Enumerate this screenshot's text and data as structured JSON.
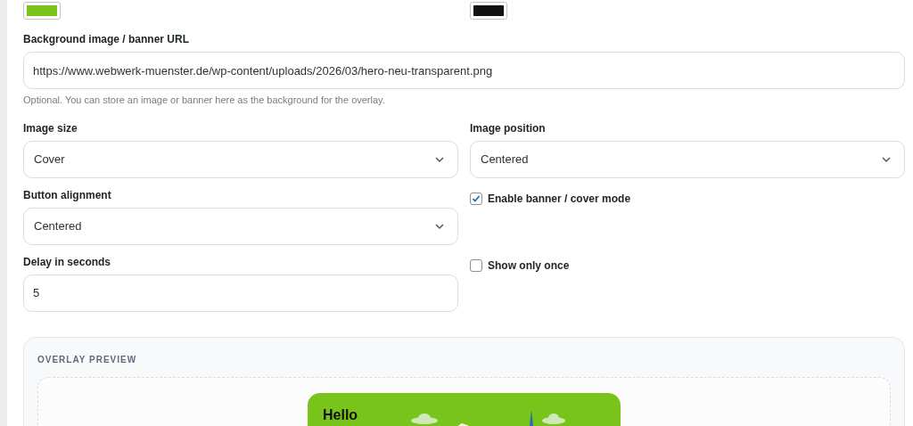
{
  "color_swatches": [
    {
      "color": "#7ac31b"
    },
    {
      "color": "#111111"
    }
  ],
  "background_url": {
    "label": "Background image / banner URL",
    "value": "https://www.webwerk-muenster.de/wp-content/uploads/2026/03/hero-neu-transparent.png",
    "help": "Optional. You can store an image or banner here as the background for the overlay."
  },
  "image_size": {
    "label": "Image size",
    "value": "Cover"
  },
  "image_position": {
    "label": "Image position",
    "value": "Centered"
  },
  "button_alignment": {
    "label": "Button alignment",
    "value": "Centered"
  },
  "delay": {
    "label": "Delay in seconds",
    "value": "5"
  },
  "checkboxes": [
    {
      "label": "Enable banner / cover mode",
      "checked": true
    },
    {
      "label": "Show only once",
      "checked": false
    }
  ],
  "preview": {
    "title": "OVERLAY PREVIEW",
    "banner_heading": "Hello"
  }
}
